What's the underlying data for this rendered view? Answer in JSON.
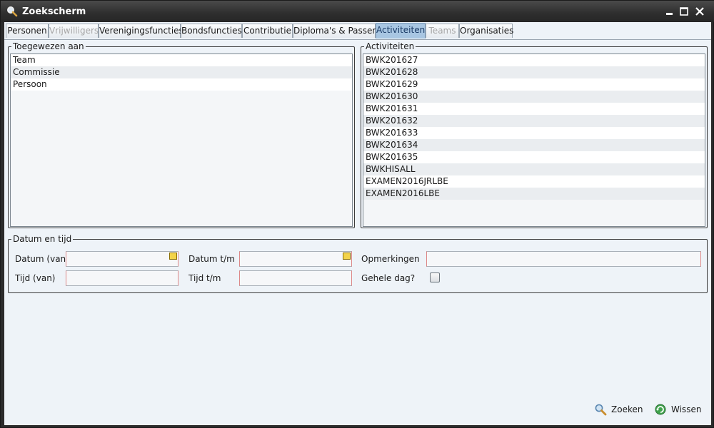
{
  "window": {
    "title": "Zoekscherm"
  },
  "tabs": [
    {
      "label": "Personen",
      "state": "normal"
    },
    {
      "label": "Vrijwilligers",
      "state": "disabled"
    },
    {
      "label": "Verenigingsfuncties",
      "state": "normal"
    },
    {
      "label": "Bondsfuncties",
      "state": "normal"
    },
    {
      "label": "Contributie",
      "state": "normal"
    },
    {
      "label": "Diploma's & Passen",
      "state": "normal"
    },
    {
      "label": "Activiteiten",
      "state": "active"
    },
    {
      "label": "Teams",
      "state": "disabled"
    },
    {
      "label": "Organisaties",
      "state": "normal"
    }
  ],
  "toegewezen": {
    "title": "Toegewezen aan",
    "items": [
      "Team",
      "Commissie",
      "Persoon"
    ]
  },
  "activiteiten": {
    "title": "Activiteiten",
    "items": [
      "BWK201627",
      "BWK201628",
      "BWK201629",
      "BWK201630",
      "BWK201631",
      "BWK201632",
      "BWK201633",
      "BWK201634",
      "BWK201635",
      "BWKHISALL",
      "EXAMEN2016JRLBE",
      "EXAMEN2016LBE"
    ]
  },
  "datum": {
    "title": "Datum en tijd",
    "datum_van_label": "Datum (van)",
    "datum_tm_label": "Datum t/m",
    "opmerkingen_label": "Opmerkingen",
    "tijd_van_label": "Tijd (van)",
    "tijd_tm_label": "Tijd t/m",
    "gehele_dag_label": "Gehele dag?",
    "datum_van_value": "",
    "datum_tm_value": "",
    "opmerkingen_value": "",
    "tijd_van_value": "",
    "tijd_tm_value": "",
    "gehele_dag_checked": false
  },
  "actions": {
    "zoeken": "Zoeken",
    "wissen": "Wissen"
  },
  "icons": {
    "title": "search-icon",
    "zoeken": "search-icon",
    "wissen": "erase-icon"
  },
  "colors": {
    "active_tab": "#a8c6e2",
    "client_bg": "#eef3f8",
    "titlebar": "#2e2e2e"
  }
}
